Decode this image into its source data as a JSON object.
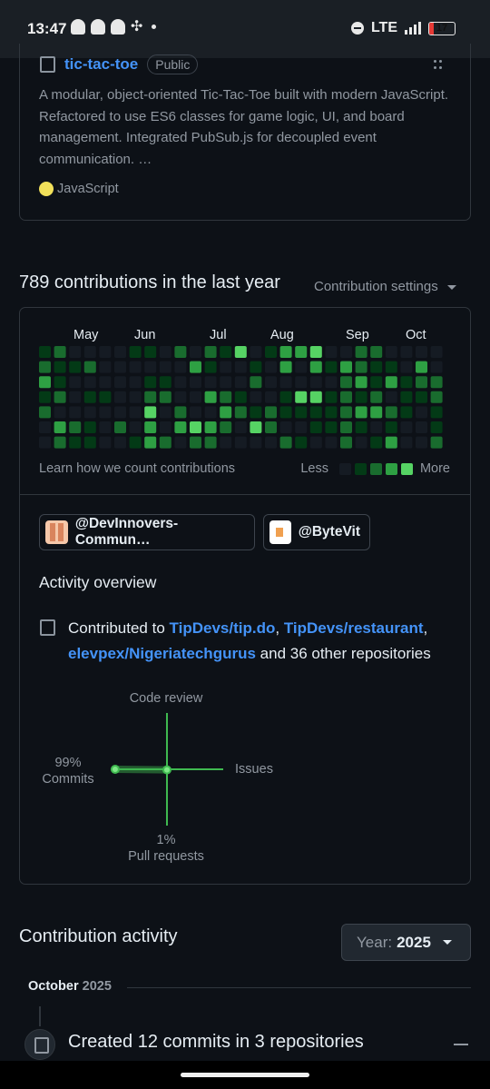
{
  "status_bar": {
    "time": "13:47",
    "network": "LTE",
    "battery": "17",
    "notification_icons": [
      "snapchat-icon",
      "snapchat-icon",
      "snapchat-icon",
      "fan-icon"
    ]
  },
  "repo": {
    "name": "tic-tac-toe",
    "visibility": "Public",
    "description": "A modular, object-oriented Tic-Tac-Toe built with modern JavaScript. Refactored to use ES6 classes for game logic, UI, and board management. Integrated PubSub.js for decoupled event communication. …",
    "language": "JavaScript",
    "language_color": "#f1e05a"
  },
  "contributions": {
    "title": "789 contributions in the last year",
    "settings_label": "Contribution settings",
    "months": [
      "May",
      "Jun",
      "Jul",
      "Aug",
      "Sep",
      "Oct"
    ],
    "learn_link": "Learn how we count contributions",
    "legend_less": "Less",
    "legend_more": "More",
    "level_colors": [
      "#151b23",
      "#033a16",
      "#196c2e",
      "#2ea043",
      "#56d364"
    ],
    "grid": [
      [
        1,
        2,
        0,
        0,
        0,
        0,
        1,
        1,
        0,
        2,
        0,
        2,
        1,
        4,
        0,
        1,
        3,
        3,
        4,
        0,
        0,
        2,
        2,
        0,
        0,
        0,
        0
      ],
      [
        2,
        1,
        1,
        2,
        0,
        0,
        0,
        0,
        0,
        0,
        3,
        1,
        0,
        0,
        1,
        0,
        3,
        0,
        3,
        1,
        3,
        2,
        1,
        1,
        0,
        3,
        0
      ],
      [
        3,
        1,
        0,
        0,
        0,
        0,
        0,
        1,
        1,
        0,
        0,
        0,
        0,
        0,
        2,
        0,
        0,
        0,
        0,
        0,
        2,
        3,
        1,
        3,
        1,
        2,
        2
      ],
      [
        1,
        2,
        0,
        1,
        1,
        0,
        0,
        2,
        2,
        0,
        0,
        3,
        2,
        1,
        0,
        0,
        1,
        4,
        4,
        1,
        2,
        1,
        2,
        0,
        1,
        1,
        2
      ],
      [
        2,
        0,
        0,
        0,
        0,
        0,
        0,
        4,
        0,
        2,
        0,
        0,
        3,
        2,
        1,
        2,
        1,
        1,
        1,
        1,
        2,
        3,
        3,
        2,
        1,
        0,
        1
      ],
      [
        0,
        3,
        2,
        1,
        0,
        2,
        0,
        3,
        0,
        3,
        4,
        3,
        2,
        0,
        4,
        2,
        0,
        0,
        1,
        1,
        2,
        1,
        0,
        1,
        0,
        0,
        1
      ],
      [
        0,
        2,
        1,
        1,
        0,
        0,
        1,
        3,
        2,
        0,
        2,
        2,
        0,
        0,
        0,
        0,
        2,
        1,
        0,
        0,
        2,
        0,
        1,
        3,
        0,
        0,
        2
      ],
      [
        0,
        1,
        0,
        0,
        0,
        2,
        0,
        0,
        0,
        3,
        0,
        0,
        0,
        0,
        3,
        1,
        0,
        0,
        1,
        0,
        0,
        0,
        1,
        0,
        0,
        0,
        0
      ]
    ]
  },
  "organizations": [
    {
      "name": "@DevInnovers-Commun…"
    },
    {
      "name": "@ByteVit"
    }
  ],
  "activity_overview": {
    "title": "Activity overview",
    "prefix": "Contributed to",
    "repos": [
      "TipDevs/tip.do",
      "TipDevs/restaurant",
      "elevpex/Nigeriatechgurus"
    ],
    "separator": ",",
    "suffix": "and 36 other repositories",
    "axes": {
      "code_review": {
        "label": "Code review",
        "percent": null
      },
      "issues": {
        "label": "Issues",
        "percent": null
      },
      "pull_requests": {
        "label": "Pull requests",
        "percent": "1%",
        "value": 1
      },
      "commits": {
        "label": "Commits",
        "percent": "99%",
        "value": 99
      }
    }
  },
  "contribution_activity": {
    "title": "Contribution activity",
    "year_prefix": "Year:",
    "year": "2025",
    "month": "October",
    "month_year": "2025",
    "entry": "Created 12 commits in 3 repositories"
  }
}
